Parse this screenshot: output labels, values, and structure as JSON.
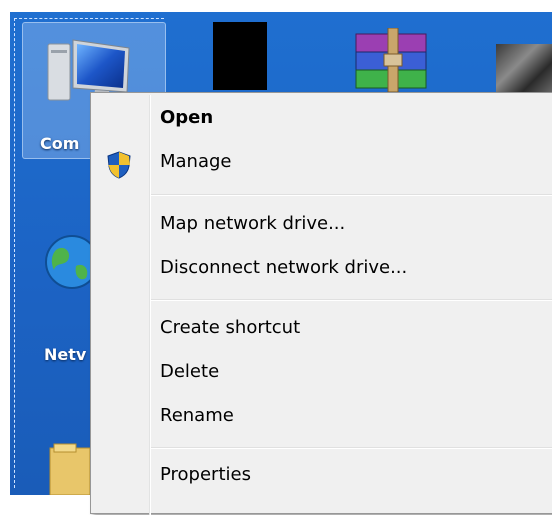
{
  "desktop": {
    "icons": [
      {
        "label": "Com",
        "icon": "computer-icon"
      },
      {
        "label": "Netv",
        "icon": "network-icon"
      }
    ]
  },
  "context_menu": {
    "items": [
      {
        "label": "Open",
        "bold": true
      },
      {
        "label": "Manage",
        "icon": "shield-icon"
      },
      {
        "label": "Map network drive..."
      },
      {
        "label": "Disconnect network drive..."
      },
      {
        "label": "Create shortcut"
      },
      {
        "label": "Delete"
      },
      {
        "label": "Rename"
      },
      {
        "label": "Properties"
      }
    ]
  },
  "colors": {
    "desktop_blue": "#1f6fd0",
    "menu_bg": "#f0f0f0",
    "menu_border": "#979797"
  }
}
